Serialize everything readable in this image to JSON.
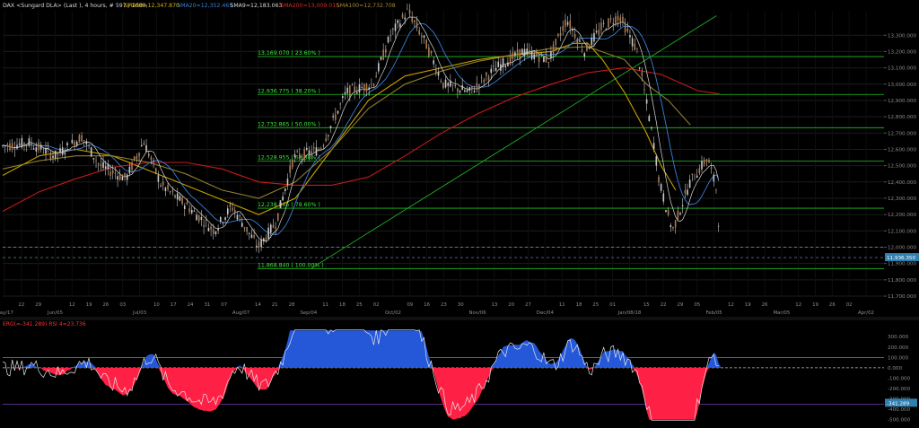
{
  "header": {
    "symbol": "DAX <Sungard DLA> (Last ), 4 hours, # 597 / 1000,",
    "indicators": [
      {
        "label": "SMA50=12,347.870",
        "color": "#d8b000"
      },
      {
        "label": "SMA20=12,352.465",
        "color": "#3a7fd5"
      },
      {
        "label": "SMA9=12,183.063",
        "color": "#d9d9d9"
      },
      {
        "label": "SMA200=13,009.015",
        "color": "#d42a2a"
      },
      {
        "label": "SMA100=12,732.708",
        "color": "#a08a30"
      }
    ]
  },
  "colors": {
    "background": "#000000",
    "fib": "#1fbf1f",
    "fib_text": "#3ce63c",
    "trendline": "#22a822",
    "candle": "#c8c8c8",
    "candle_down": "#b07a4a",
    "sma50": "#c8a000",
    "sma20": "#3a7fd5",
    "sma9": "#d9d9d9",
    "sma200": "#c41a1a",
    "sma100": "#8f7d2a",
    "osc_pos": "#2458d8",
    "osc_neg": "#ff2045",
    "rsi": "#e6e6e6",
    "grid": "#1c1c1c",
    "axis_text": "#8c8c8c"
  },
  "chart_data": [
    {
      "type": "candlestick",
      "title": "",
      "ylim": [
        11700,
        13450
      ],
      "y_ticks": [
        "13,300.000",
        "13,200.000",
        "13,100.000",
        "13,000.000",
        "12,900.000",
        "12,800.000",
        "12,700.000",
        "12,600.000",
        "12,500.000",
        "12,400.000",
        "12,300.000",
        "12,200.000",
        "12,100.000",
        "12,000.000",
        "11,900.000",
        "11,800.000",
        "11,700.000"
      ],
      "x_ticks": [
        "May/17",
        "22",
        "29",
        "Jun/05",
        "12",
        "19",
        "26",
        "03",
        "Jul/03",
        "10",
        "17",
        "24",
        "31",
        "07",
        "Aug/07",
        "14",
        "21",
        "28",
        "Sep/04",
        "11",
        "18",
        "25",
        "02",
        "Oct/02",
        "09",
        "16",
        "23",
        "30",
        "Nov/06",
        "13",
        "20",
        "27",
        "Dec/04",
        "11",
        "18",
        "25",
        "01",
        "Jan/08/18",
        "15",
        "22",
        "29",
        "05",
        "Feb/05",
        "12",
        "19",
        "26",
        "Mar/05",
        "12",
        "19",
        "26",
        "02",
        "Apr/02"
      ],
      "price_current_label": "11,936.350",
      "horizontal_dashed": [
        12000,
        11936.35
      ],
      "fib_levels": [
        {
          "price": 13169.07,
          "label": "13,169.070 ( 23.60% )"
        },
        {
          "price": 12936.775,
          "label": "12,936.775 ( 38.20% )"
        },
        {
          "price": 12732.865,
          "label": "12,732.865 ( 50.00% )"
        },
        {
          "price": 12528.955,
          "label": "12,528.955 ( 61.80% )"
        },
        {
          "price": 12238.865,
          "label": "12,238.865 ( 78.60% )"
        },
        {
          "price": 11868.84,
          "label": "11,868.840 ( 100.00% )"
        }
      ],
      "trendline": {
        "from": {
          "x_index": 0.35,
          "price": 11870
        },
        "to": {
          "x_index": 0.81,
          "price": 13420
        }
      },
      "series": [
        {
          "name": "SMA50",
          "points": [
            [
              0.0,
              12440
            ],
            [
              0.05,
              12560
            ],
            [
              0.1,
              12600
            ],
            [
              0.15,
              12560
            ],
            [
              0.2,
              12470
            ],
            [
              0.25,
              12380
            ],
            [
              0.3,
              12290
            ],
            [
              0.35,
              12200
            ],
            [
              0.4,
              12300
            ],
            [
              0.45,
              12600
            ],
            [
              0.5,
              12900
            ],
            [
              0.55,
              13050
            ],
            [
              0.6,
              13100
            ],
            [
              0.65,
              13150
            ],
            [
              0.7,
              13180
            ],
            [
              0.75,
              13200
            ],
            [
              0.78,
              13250
            ],
            [
              0.8,
              13250
            ],
            [
              0.82,
              13150
            ],
            [
              0.85,
              12950
            ],
            [
              0.88,
              12700
            ],
            [
              0.9,
              12500
            ],
            [
              0.92,
              12350
            ]
          ]
        },
        {
          "name": "SMA200",
          "points": [
            [
              0.0,
              12220
            ],
            [
              0.05,
              12340
            ],
            [
              0.1,
              12420
            ],
            [
              0.15,
              12490
            ],
            [
              0.2,
              12520
            ],
            [
              0.25,
              12520
            ],
            [
              0.3,
              12480
            ],
            [
              0.35,
              12400
            ],
            [
              0.4,
              12380
            ],
            [
              0.45,
              12380
            ],
            [
              0.5,
              12430
            ],
            [
              0.55,
              12560
            ],
            [
              0.6,
              12700
            ],
            [
              0.65,
              12820
            ],
            [
              0.7,
              12920
            ],
            [
              0.75,
              13000
            ],
            [
              0.8,
              13070
            ],
            [
              0.85,
              13100
            ],
            [
              0.9,
              13060
            ],
            [
              0.95,
              12960
            ],
            [
              0.98,
              12940
            ]
          ]
        },
        {
          "name": "SMA100",
          "points": [
            [
              0.0,
              12480
            ],
            [
              0.05,
              12530
            ],
            [
              0.1,
              12560
            ],
            [
              0.15,
              12560
            ],
            [
              0.2,
              12520
            ],
            [
              0.25,
              12450
            ],
            [
              0.3,
              12350
            ],
            [
              0.35,
              12300
            ],
            [
              0.4,
              12400
            ],
            [
              0.45,
              12600
            ],
            [
              0.5,
              12850
            ],
            [
              0.55,
              13000
            ],
            [
              0.6,
              13080
            ],
            [
              0.65,
              13140
            ],
            [
              0.7,
              13180
            ],
            [
              0.75,
              13220
            ],
            [
              0.8,
              13230
            ],
            [
              0.85,
              13150
            ],
            [
              0.88,
              13000
            ],
            [
              0.91,
              12900
            ],
            [
              0.94,
              12750
            ]
          ]
        }
      ]
    },
    {
      "type": "oscillator",
      "label": "ERG(=-341.289) RSI 4=23.736",
      "ylim": [
        -520,
        380
      ],
      "y_ticks": [
        "300.000",
        "200.000",
        "100.000",
        "0.000",
        "-100.000",
        "-200.000",
        "-300.000",
        "-400.000",
        "-500.000"
      ],
      "current_label": "-341.289",
      "reference_lines": [
        {
          "value": 100,
          "color": "#b08020"
        },
        {
          "value": 0,
          "color": "#bbbbbb",
          "dashed": true
        },
        {
          "value": -350,
          "color": "#6a3fb0"
        }
      ]
    }
  ]
}
